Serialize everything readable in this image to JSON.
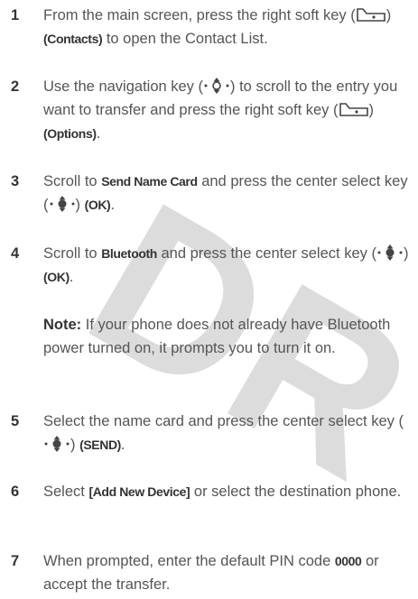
{
  "watermark": "DR",
  "steps": [
    {
      "number": "1",
      "pre": "From the main screen, press the right soft key (",
      "mid": ") ",
      "key": "(Contacts)",
      "post": " to open the Contact List."
    },
    {
      "number": "2",
      "pre": "Use the navigation key (",
      "mid": ") to scroll to the entry you want to transfer and press the right soft key (",
      "mid2": ") ",
      "key": "(Options)",
      "post": "."
    },
    {
      "number": "3",
      "pre": "Scroll to ",
      "key1": "Send Name Card",
      "mid": " and press the center select key (",
      "mid2": ") ",
      "key2": "(OK)",
      "post": "."
    },
    {
      "number": "4",
      "pre": "Scroll to ",
      "key1": "Bluetooth",
      "mid": " and press the center select key (",
      "mid2": ") ",
      "key2": "(OK)",
      "post": "."
    },
    {
      "number": "5",
      "pre": "Select the name card and press the center select key (",
      "mid": ") ",
      "key": "(SEND)",
      "post": "."
    },
    {
      "number": "6",
      "pre": "Select ",
      "key": "[Add New Device]",
      "post": " or select the destination phone."
    },
    {
      "number": "7",
      "pre": "When prompted, enter the default PIN code ",
      "key": "0000",
      "post": " or accept the transfer."
    }
  ],
  "note": {
    "label": "Note:",
    "text": " If your phone does not already have Bluetooth power turned on, it prompts you to turn it on."
  }
}
